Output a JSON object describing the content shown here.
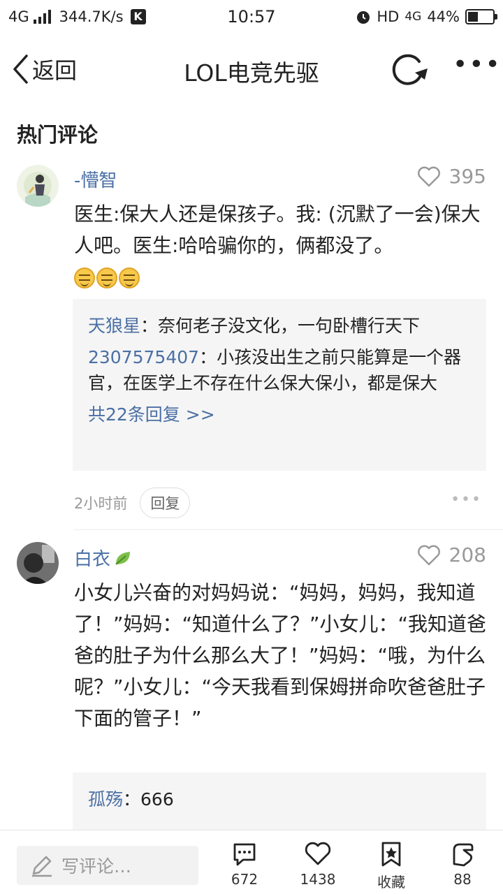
{
  "statusbar": {
    "network": "4G",
    "speed": "344.7K/s",
    "k_badge": "K",
    "time": "10:57",
    "hd": "HD",
    "network2": "4G",
    "battery": "44%"
  },
  "navbar": {
    "back_label": "返回",
    "title": "LOL电竞先驱"
  },
  "section": {
    "title": "热门评论"
  },
  "comments": [
    {
      "username": "-懵智",
      "likes": "395",
      "text": "医生:保大人还是保孩子。我: (沉默了一会)保大人吧。医生:哈哈骗你的，俩都没了。",
      "replies": [
        {
          "name": "天狼星",
          "sep": "：",
          "text": "奈何老子没文化，一句卧槽行天下"
        },
        {
          "name": "2307575407",
          "sep": "：",
          "text": "小孩没出生之前只能算是一个器官，在医学上不存在什么保大保小，都是保大"
        }
      ],
      "more_replies": "共22条回复 >>",
      "time": "2小时前",
      "reply_label": "回复"
    },
    {
      "username": "白衣",
      "likes": "208",
      "text": "小女儿兴奋的对妈妈说：“妈妈，妈妈，我知道了！”妈妈：“知道什么了？”小女儿：“我知道爸爸的肚子为什么那么大了！”妈妈：“哦，为什么呢？”小女儿：“今天我看到保姆拼命吹爸爸肚子下面的管子！”",
      "replies": [
        {
          "name": "孤殇",
          "sep": "：",
          "text": "666"
        }
      ]
    }
  ],
  "bottombar": {
    "placeholder": "写评论…",
    "comments_count": "672",
    "likes_count": "1438",
    "favorite_label": "收藏",
    "share_count": "88"
  },
  "colors": {
    "link": "#4a6fa5",
    "reply_bg": "#f5f5f5",
    "muted": "#999999"
  }
}
